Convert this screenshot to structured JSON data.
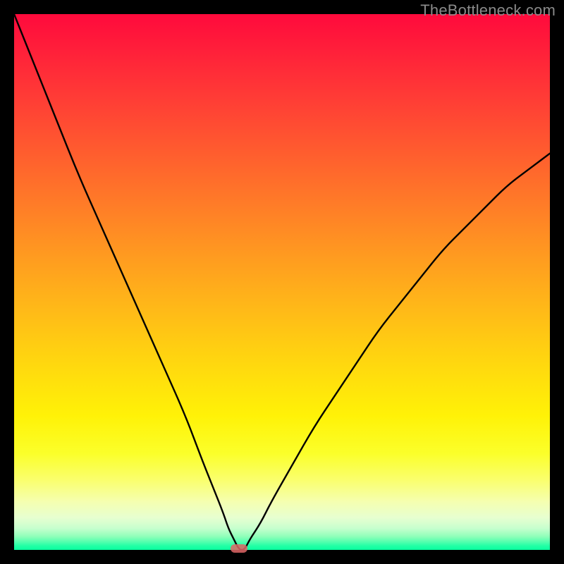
{
  "watermark": "TheBottleneck.com",
  "colors": {
    "frame": "#000000",
    "curve": "#000000",
    "marker": "#e06666"
  },
  "chart_data": {
    "type": "line",
    "title": "",
    "xlabel": "",
    "ylabel": "",
    "xlim": [
      0,
      100
    ],
    "ylim": [
      0,
      100
    ],
    "marker": {
      "x": 42,
      "y": 0
    },
    "series": [
      {
        "name": "bottleneck-curve",
        "x": [
          0,
          4,
          8,
          12,
          16,
          20,
          24,
          28,
          32,
          35,
          37,
          39,
          40,
          41,
          42,
          43,
          44,
          46,
          48,
          52,
          56,
          60,
          64,
          68,
          72,
          76,
          80,
          84,
          88,
          92,
          96,
          100
        ],
        "values": [
          100,
          90,
          80,
          70,
          61,
          52,
          43,
          34,
          25,
          17,
          12,
          7,
          4,
          2,
          0,
          0,
          2,
          5,
          9,
          16,
          23,
          29,
          35,
          41,
          46,
          51,
          56,
          60,
          64,
          68,
          71,
          74
        ]
      }
    ],
    "grid": false,
    "legend": false,
    "background_gradient": {
      "top": "#ff0a3c",
      "mid": "#ffd70f",
      "bottom": "#0aff9f"
    }
  }
}
